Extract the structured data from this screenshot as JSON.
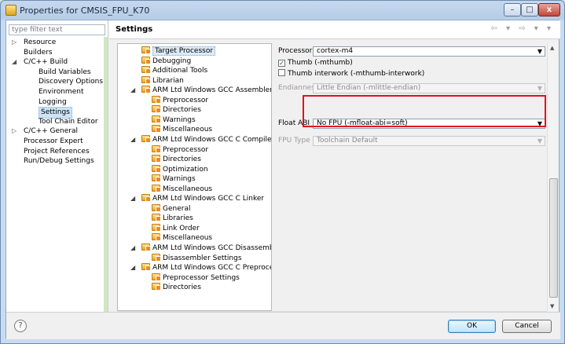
{
  "window": {
    "title": "Properties for CMSIS_FPU_K70",
    "minimize_glyph": "–",
    "maximize_glyph": "□",
    "close_glyph": "x"
  },
  "filter": {
    "placeholder": "type filter text"
  },
  "nav": {
    "items": [
      {
        "label": "Resource",
        "expander": "▷",
        "indent": 0
      },
      {
        "label": "Builders",
        "expander": "",
        "indent": 0
      },
      {
        "label": "C/C++ Build",
        "expander": "◢",
        "indent": 0
      },
      {
        "label": "Build Variables",
        "expander": "",
        "indent": 1
      },
      {
        "label": "Discovery Options",
        "expander": "",
        "indent": 1
      },
      {
        "label": "Environment",
        "expander": "",
        "indent": 1
      },
      {
        "label": "Logging",
        "expander": "",
        "indent": 1
      },
      {
        "label": "Settings",
        "expander": "",
        "indent": 1,
        "selected": true
      },
      {
        "label": "Tool Chain Editor",
        "expander": "",
        "indent": 1
      },
      {
        "label": "C/C++ General",
        "expander": "▷",
        "indent": 0
      },
      {
        "label": "Processor Expert",
        "expander": "",
        "indent": 0
      },
      {
        "label": "Project References",
        "expander": "",
        "indent": 0
      },
      {
        "label": "Run/Debug Settings",
        "expander": "",
        "indent": 0
      }
    ]
  },
  "header": {
    "title": "Settings",
    "nav_arrows": "⇦ ▾ ⇨ ▾ ▾"
  },
  "tree": {
    "items": [
      {
        "label": "Target Processor",
        "level": 1,
        "selected": true
      },
      {
        "label": "Debugging",
        "level": 1
      },
      {
        "label": "Additional Tools",
        "level": 1
      },
      {
        "label": "Librarian",
        "level": 1
      },
      {
        "label": "ARM Ltd Windows GCC Assembler",
        "level": 0,
        "twisty": "◢"
      },
      {
        "label": "Preprocessor",
        "level": 2
      },
      {
        "label": "Directories",
        "level": 2
      },
      {
        "label": "Warnings",
        "level": 2
      },
      {
        "label": "Miscellaneous",
        "level": 2
      },
      {
        "label": "ARM Ltd Windows GCC C Compiler",
        "level": 0,
        "twisty": "◢"
      },
      {
        "label": "Preprocessor",
        "level": 2
      },
      {
        "label": "Directories",
        "level": 2
      },
      {
        "label": "Optimization",
        "level": 2
      },
      {
        "label": "Warnings",
        "level": 2
      },
      {
        "label": "Miscellaneous",
        "level": 2
      },
      {
        "label": "ARM Ltd Windows GCC C Linker",
        "level": 0,
        "twisty": "◢"
      },
      {
        "label": "General",
        "level": 2
      },
      {
        "label": "Libraries",
        "level": 2
      },
      {
        "label": "Link Order",
        "level": 2
      },
      {
        "label": "Miscellaneous",
        "level": 2
      },
      {
        "label": "ARM Ltd Windows GCC Disassembler",
        "level": 0,
        "twisty": "◢"
      },
      {
        "label": "Disassembler Settings",
        "level": 2
      },
      {
        "label": "ARM Ltd Windows GCC C Preprocessor",
        "level": 0,
        "twisty": "◢"
      },
      {
        "label": "Preprocessor Settings",
        "level": 2
      },
      {
        "label": "Directories",
        "level": 2
      }
    ]
  },
  "form": {
    "processor_label": "Processor",
    "processor_value": "cortex-m4",
    "thumb_label": "Thumb (-mthumb)",
    "thumb_checked": true,
    "thumb_interwork_label": "Thumb interwork (-mthumb-interwork)",
    "thumb_interwork_checked": false,
    "endianness_label": "Endianness",
    "endianness_value": "Little Endian (-mlittle-endian)",
    "float_abi_label": "Float ABI",
    "float_abi_value": "No FPU (-mfloat-abi=soft)",
    "fpu_type_label": "FPU Type",
    "fpu_type_value": "Toolchain Default",
    "dropdown_arrow": "▼",
    "check_mark": "✓"
  },
  "scrollbar": {
    "up": "▲",
    "down": "▼",
    "left": "◄",
    "right": "►",
    "grip": "|||"
  },
  "footer": {
    "help_glyph": "?",
    "ok_label": "OK",
    "cancel_label": "Cancel"
  },
  "colors": {
    "highlight_border": "#e0111f",
    "selection_bg": "#dceaf7",
    "window_frame": "#b7cde6"
  }
}
